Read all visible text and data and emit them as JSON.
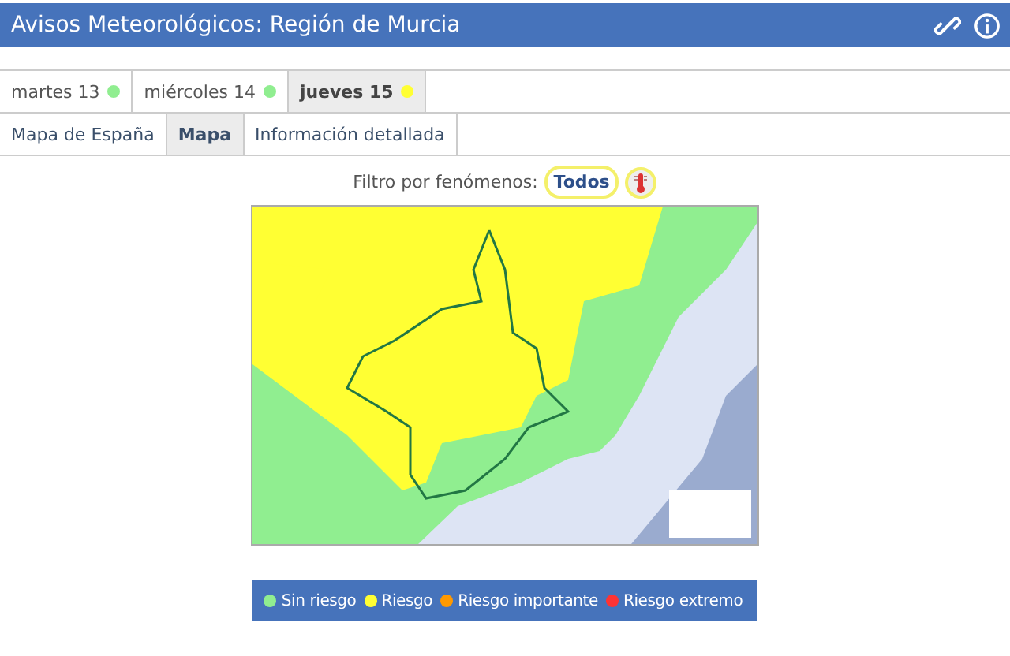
{
  "window": {
    "title": "Avisos Meteorológicos: Región de Murcia"
  },
  "days": [
    {
      "label": "martes 13",
      "color": "#90ee90",
      "selected": false
    },
    {
      "label": "miércoles 14",
      "color": "#90ee90",
      "selected": false
    },
    {
      "label": "jueves 15",
      "color": "#ffff33",
      "selected": true
    }
  ],
  "views": [
    {
      "label": "Mapa de España",
      "selected": false
    },
    {
      "label": "Mapa",
      "selected": true
    },
    {
      "label": "Información detallada",
      "selected": false
    }
  ],
  "filter": {
    "label": "Filtro por fenómenos:",
    "options": [
      {
        "kind": "text",
        "label": "Todos",
        "selected": true
      },
      {
        "kind": "thermometer",
        "selected": true
      }
    ]
  },
  "legend": [
    {
      "label": "Sin riesgo",
      "color": "#90ee90"
    },
    {
      "label": "Riesgo",
      "color": "#ffff33"
    },
    {
      "label": "Riesgo importante",
      "color": "#ff9900"
    },
    {
      "label": "Riesgo extremo",
      "color": "#ff3333"
    }
  ]
}
